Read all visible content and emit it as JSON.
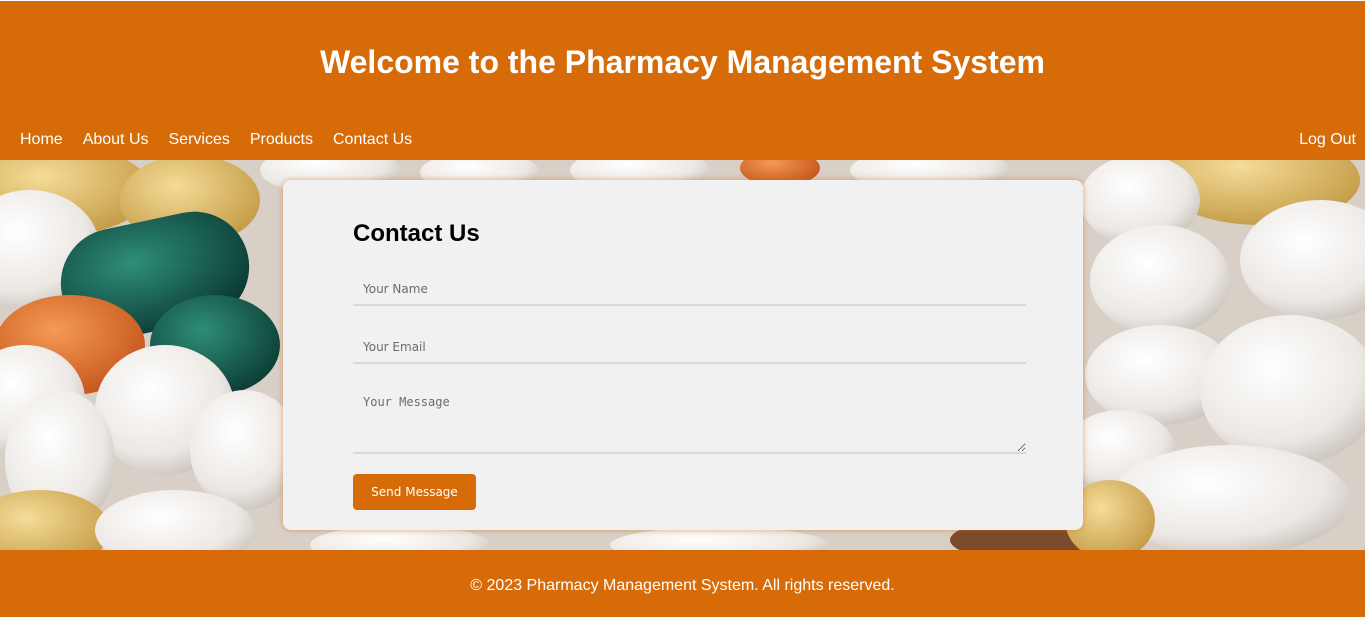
{
  "header": {
    "title": "Welcome to the Pharmacy Management System",
    "nav": [
      "Home",
      "About Us",
      "Services",
      "Products",
      "Contact Us"
    ],
    "logout_label": "Log Out"
  },
  "contact": {
    "title": "Contact Us",
    "name_placeholder": "Your Name",
    "email_placeholder": "Your Email",
    "message_placeholder": "Your Message",
    "send_label": "Send Message"
  },
  "footer": {
    "text": "© 2023 Pharmacy Management System. All rights reserved."
  },
  "colors": {
    "brand": "#d76b08",
    "card": "#f1f1f1"
  },
  "background_image": "pills-photo"
}
